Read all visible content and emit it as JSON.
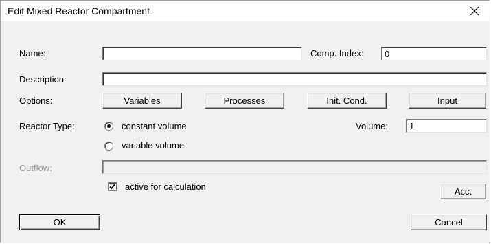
{
  "window": {
    "title": "Edit Mixed Reactor Compartment"
  },
  "icons": {
    "close": "close-icon",
    "check": "check-icon"
  },
  "fields": {
    "name": {
      "label": "Name:",
      "value": ""
    },
    "comp_index": {
      "label": "Comp. Index:",
      "value": "0"
    },
    "description": {
      "label": "Description:",
      "value": ""
    },
    "volume": {
      "label": "Volume:",
      "value": "1"
    },
    "outflow": {
      "label": "Outflow:",
      "value": ""
    }
  },
  "options": {
    "label": "Options:",
    "buttons": [
      "Variables",
      "Processes",
      "Init. Cond.",
      "Input"
    ]
  },
  "reactor_type": {
    "label": "Reactor Type:",
    "choices": [
      "constant volume",
      "variable volume"
    ],
    "selected": "constant volume"
  },
  "active_checkbox": {
    "label": "active for calculation",
    "checked": true
  },
  "buttons": {
    "acc": "Acc.",
    "ok": "OK",
    "cancel": "Cancel"
  }
}
